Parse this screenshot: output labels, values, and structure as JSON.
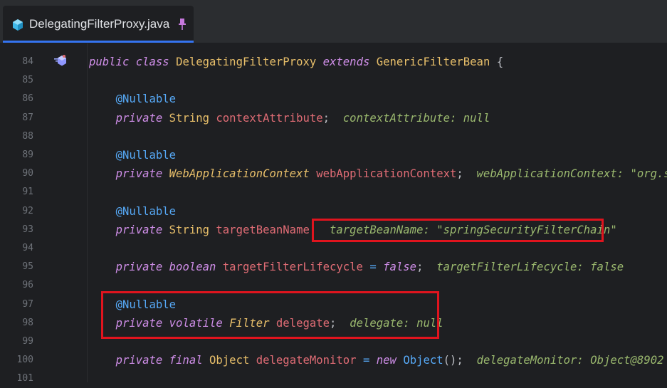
{
  "tab": {
    "filename": "DelegatingFilterProxy.java"
  },
  "lines": [
    {
      "num": "84",
      "tokens": [
        [
          "kw",
          "public"
        ],
        [
          "plain",
          " "
        ],
        [
          "kw",
          "class"
        ],
        [
          "plain",
          " "
        ],
        [
          "ty",
          "DelegatingFilterProxy"
        ],
        [
          "plain",
          " "
        ],
        [
          "kw",
          "extends"
        ],
        [
          "plain",
          " "
        ],
        [
          "ty",
          "GenericFilterBean"
        ],
        [
          "plain",
          " {"
        ]
      ]
    },
    {
      "num": "85",
      "tokens": []
    },
    {
      "num": "86",
      "tokens": [
        [
          "plain",
          "    "
        ],
        [
          "anno",
          "@Nullable"
        ]
      ]
    },
    {
      "num": "87",
      "tokens": [
        [
          "plain",
          "    "
        ],
        [
          "kw",
          "private"
        ],
        [
          "plain",
          " "
        ],
        [
          "ty",
          "String"
        ],
        [
          "plain",
          " "
        ],
        [
          "fld",
          "contextAttribute"
        ],
        [
          "plain",
          ";  "
        ],
        [
          "hint",
          "contextAttribute: null"
        ]
      ]
    },
    {
      "num": "88",
      "tokens": []
    },
    {
      "num": "89",
      "tokens": [
        [
          "plain",
          "    "
        ],
        [
          "anno",
          "@Nullable"
        ]
      ]
    },
    {
      "num": "90",
      "tokens": [
        [
          "plain",
          "    "
        ],
        [
          "kw",
          "private"
        ],
        [
          "plain",
          " "
        ],
        [
          "tyi",
          "WebApplicationContext"
        ],
        [
          "plain",
          " "
        ],
        [
          "fld",
          "webApplicationContext"
        ],
        [
          "plain",
          ";  "
        ],
        [
          "hint",
          "webApplicationContext: \"org.spri"
        ]
      ]
    },
    {
      "num": "91",
      "tokens": []
    },
    {
      "num": "92",
      "tokens": [
        [
          "plain",
          "    "
        ],
        [
          "anno",
          "@Nullable"
        ]
      ]
    },
    {
      "num": "93",
      "tokens": [
        [
          "plain",
          "    "
        ],
        [
          "kw",
          "private"
        ],
        [
          "plain",
          " "
        ],
        [
          "ty",
          "String"
        ],
        [
          "plain",
          " "
        ],
        [
          "fld",
          "targetBeanName"
        ],
        [
          "plain",
          ";  "
        ],
        [
          "hint",
          "targetBeanName: \"springSecurityFilterChain\""
        ]
      ]
    },
    {
      "num": "94",
      "tokens": []
    },
    {
      "num": "95",
      "tokens": [
        [
          "plain",
          "    "
        ],
        [
          "kw",
          "private"
        ],
        [
          "plain",
          " "
        ],
        [
          "kw",
          "boolean"
        ],
        [
          "plain",
          " "
        ],
        [
          "fld",
          "targetFilterLifecycle"
        ],
        [
          "plain",
          " "
        ],
        [
          "op",
          "="
        ],
        [
          "plain",
          " "
        ],
        [
          "kw",
          "false"
        ],
        [
          "plain",
          ";  "
        ],
        [
          "hint",
          "targetFilterLifecycle: false"
        ]
      ]
    },
    {
      "num": "96",
      "tokens": []
    },
    {
      "num": "97",
      "tokens": [
        [
          "plain",
          "    "
        ],
        [
          "anno",
          "@Nullable"
        ]
      ]
    },
    {
      "num": "98",
      "tokens": [
        [
          "plain",
          "    "
        ],
        [
          "kw",
          "private"
        ],
        [
          "plain",
          " "
        ],
        [
          "kw",
          "volatile"
        ],
        [
          "plain",
          " "
        ],
        [
          "tyi",
          "Filter"
        ],
        [
          "plain",
          " "
        ],
        [
          "fld",
          "delegate"
        ],
        [
          "plain",
          ";  "
        ],
        [
          "hint",
          "delegate: null"
        ]
      ]
    },
    {
      "num": "99",
      "tokens": []
    },
    {
      "num": "100",
      "tokens": [
        [
          "plain",
          "    "
        ],
        [
          "kw",
          "private"
        ],
        [
          "plain",
          " "
        ],
        [
          "kw",
          "final"
        ],
        [
          "plain",
          " "
        ],
        [
          "ty",
          "Object"
        ],
        [
          "plain",
          " "
        ],
        [
          "fld",
          "delegateMonitor"
        ],
        [
          "plain",
          " "
        ],
        [
          "op",
          "="
        ],
        [
          "plain",
          " "
        ],
        [
          "kw",
          "new"
        ],
        [
          "plain",
          " "
        ],
        [
          "cls2",
          "Object"
        ],
        [
          "plain",
          "();  "
        ],
        [
          "hint",
          "delegateMonitor: Object@8902"
        ]
      ]
    },
    {
      "num": "101",
      "tokens": []
    }
  ]
}
